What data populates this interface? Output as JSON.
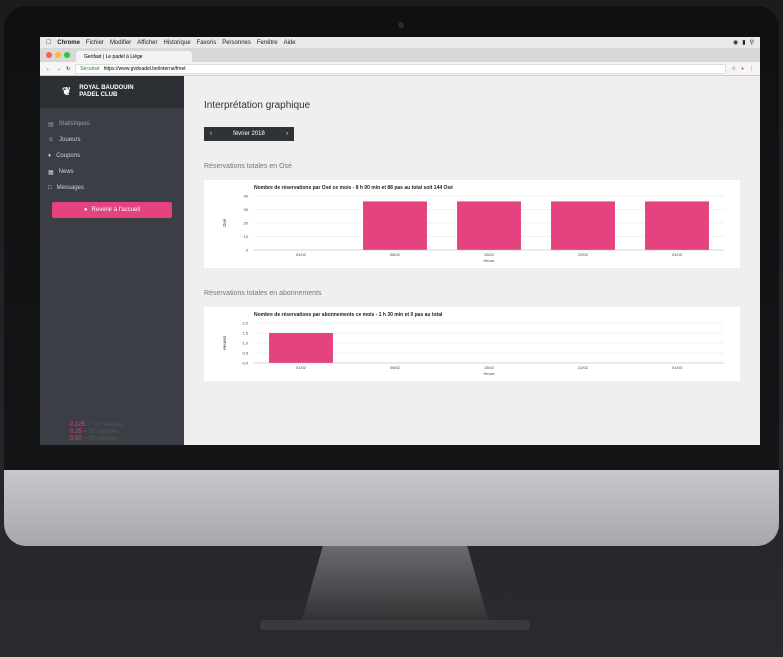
{
  "browser": {
    "menu": [
      "Chrome",
      "Fichier",
      "Modifier",
      "Afficher",
      "Historique",
      "Favoris",
      "Personnes",
      "Fenêtre",
      "Aide"
    ],
    "tab_title": "Gerifast | Le padel à Liège",
    "url_secure": "Sécurisé",
    "url": "https://www.gvdoadel.be/interne/fmet"
  },
  "sidebar": {
    "brand_line1": "ROYAL BAUDOUIN",
    "brand_line2": "PADEL CLUB",
    "items": [
      {
        "label": "Statistiques"
      },
      {
        "label": "Joueurs"
      },
      {
        "label": "Coupons"
      },
      {
        "label": "News"
      },
      {
        "label": "Messages"
      }
    ],
    "button": "Revenir à l'accueil"
  },
  "main": {
    "title": "Interprétation graphique",
    "period": "février 2018",
    "section1": "Réservations totales en Osé",
    "section2": "Réservations totales en abonnements"
  },
  "chart_data": [
    {
      "type": "bar",
      "title": "Nombre de réservations par Osé ce mois - 8 h 00 min et 88 pas au total soit 144 Osé",
      "ylabel": "Osé",
      "xlabel": "Heure",
      "categories": [
        "01/02",
        "08/02",
        "15/02",
        "22/02",
        "01/03"
      ],
      "values": [
        0,
        36,
        36,
        36,
        36
      ],
      "yticks": [
        0,
        10,
        20,
        30,
        40
      ],
      "ylim": [
        0,
        40
      ],
      "color": "#e4437f"
    },
    {
      "type": "bar",
      "title": "Nombre de réservations par abonnements ce mois - 1 h 30 min et 0 pas au total",
      "ylabel": "Heures",
      "xlabel": "Heure",
      "categories": [
        "01/02",
        "08/02",
        "15/02",
        "22/02",
        "01/03"
      ],
      "values": [
        1.5,
        0,
        0,
        0,
        0
      ],
      "yticks": [
        "0.0",
        "0.5",
        "1.0",
        "1.5",
        "2.0"
      ],
      "ylim": [
        0,
        2
      ],
      "color": "#e4437f"
    }
  ],
  "legend": [
    {
      "key": "0.125",
      "text": "= 7,5 minutes"
    },
    {
      "key": "0.25",
      "text": "= 15 minutes"
    },
    {
      "key": "0.50",
      "text": "= 30 minutes"
    }
  ]
}
